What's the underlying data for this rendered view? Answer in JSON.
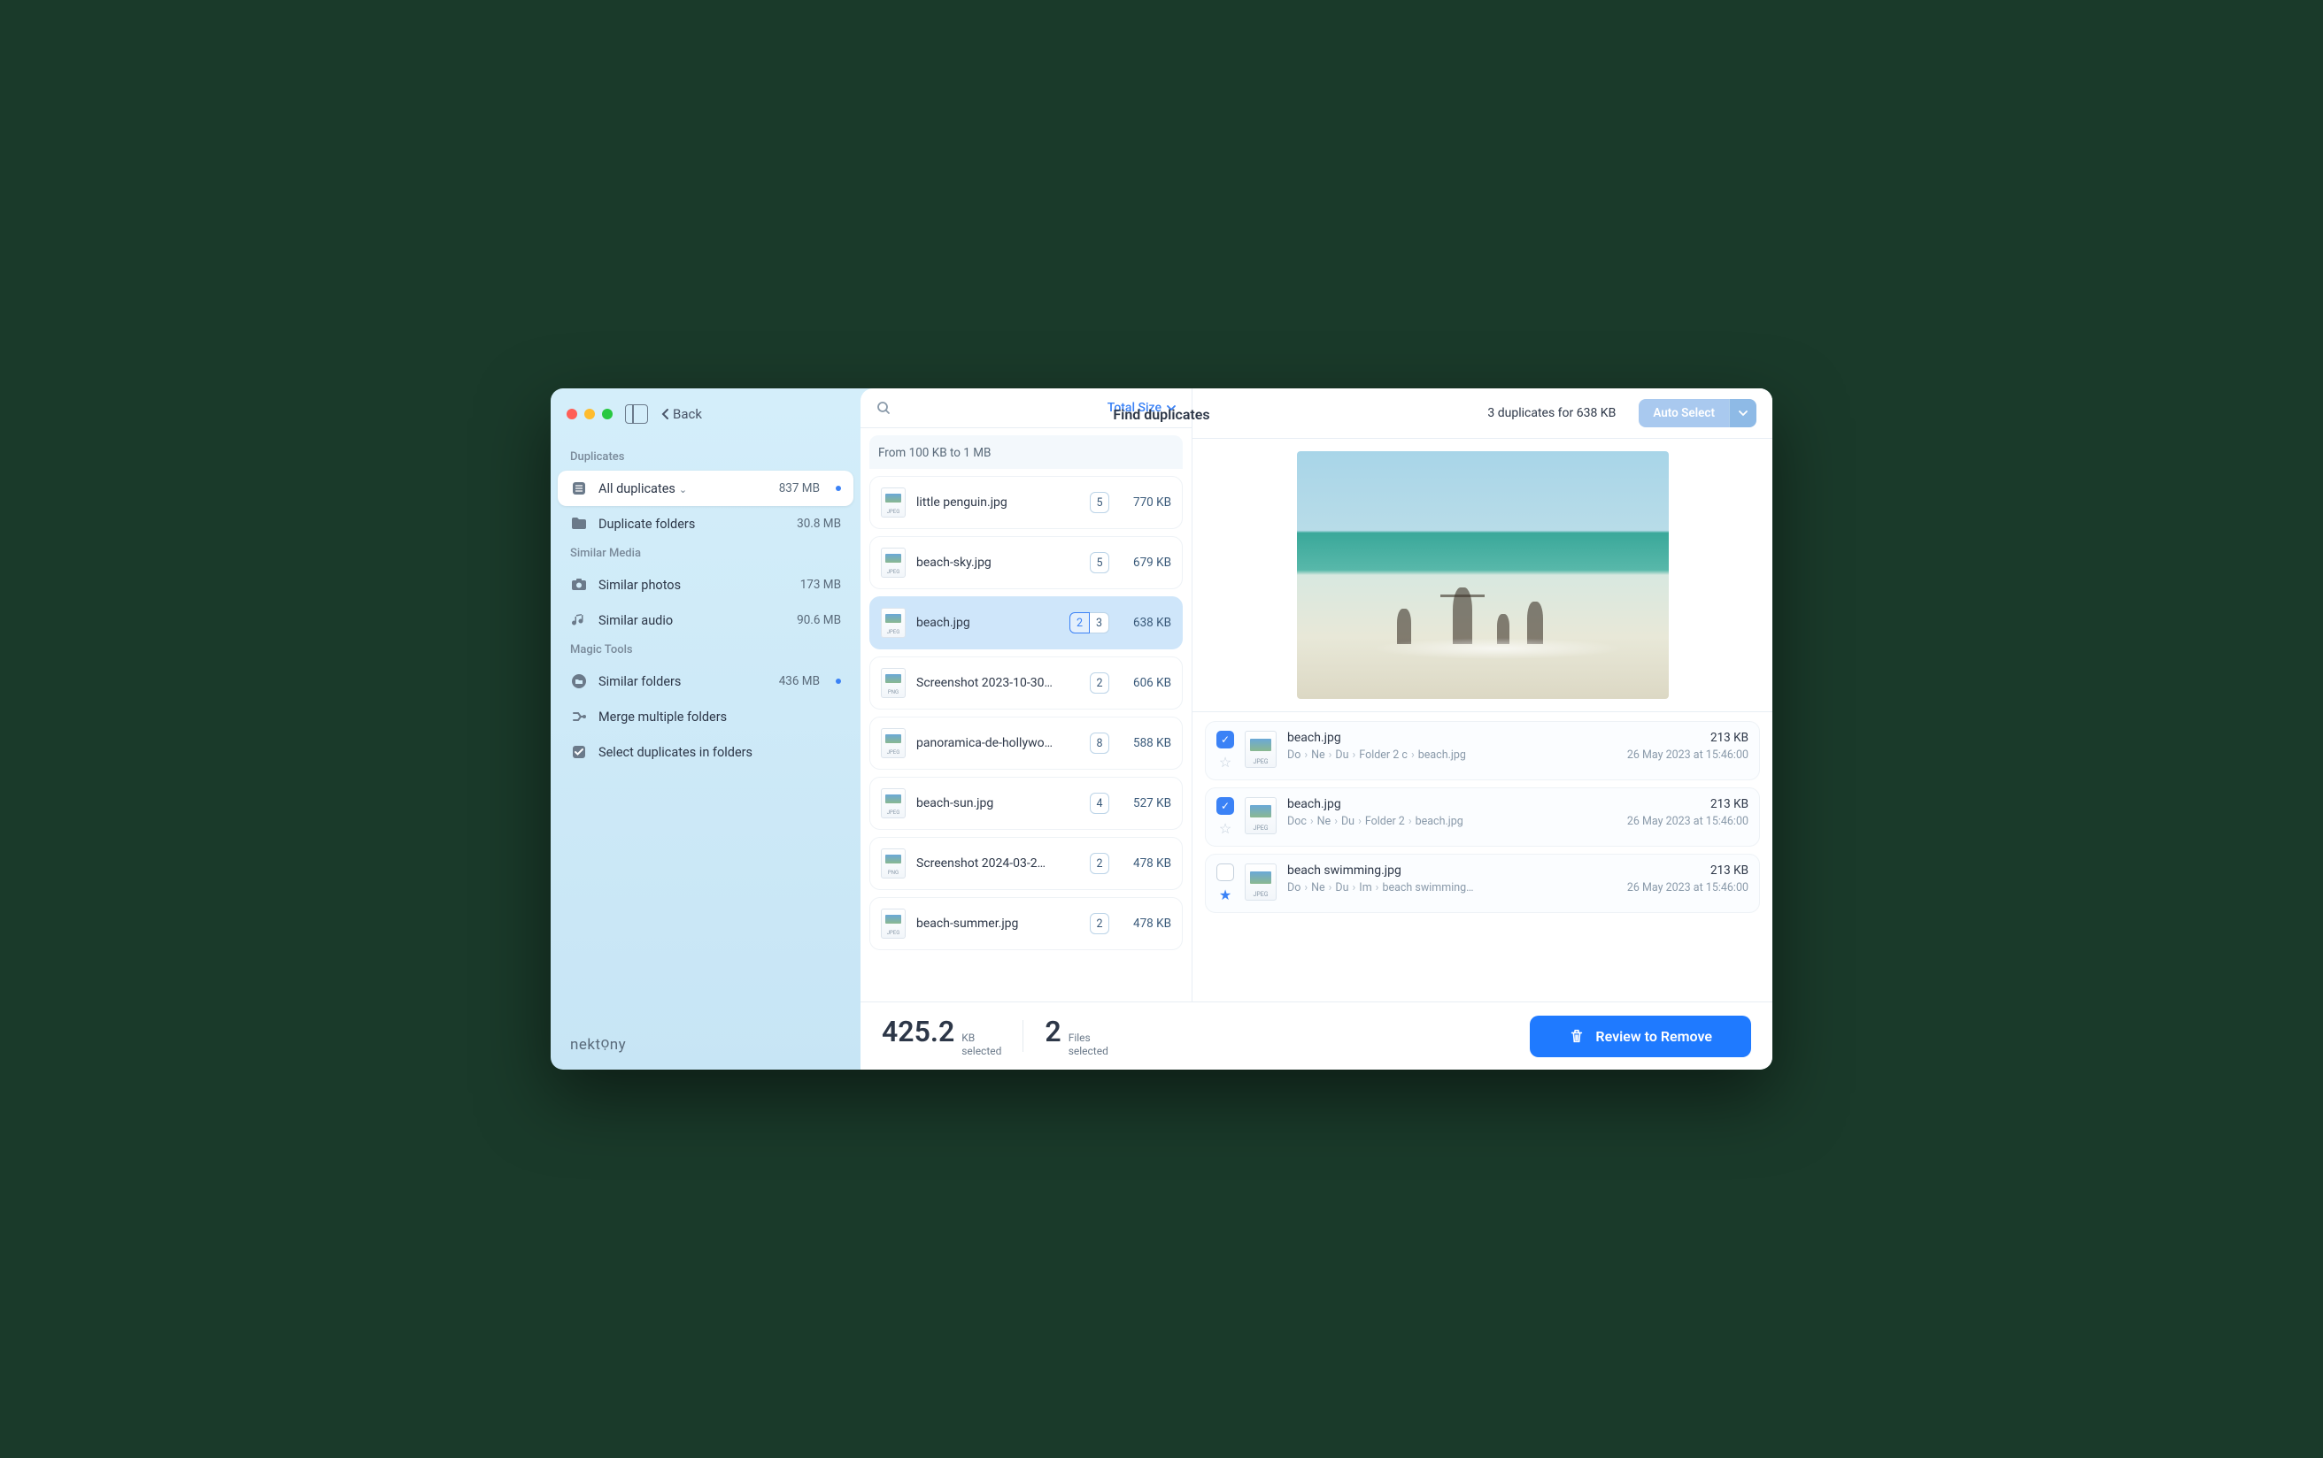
{
  "title": "Find duplicates",
  "back_label": "Back",
  "brand": "nektọny",
  "sidebar": {
    "sections": [
      {
        "label": "Duplicates",
        "items": [
          {
            "icon": "list",
            "label": "All duplicates",
            "size": "837 MB",
            "chevron": true,
            "dot": true,
            "active": true
          },
          {
            "icon": "folder",
            "label": "Duplicate folders",
            "size": "30.8 MB"
          }
        ]
      },
      {
        "label": "Similar Media",
        "items": [
          {
            "icon": "camera",
            "label": "Similar photos",
            "size": "173 MB"
          },
          {
            "icon": "music",
            "label": "Similar audio",
            "size": "90.6 MB"
          }
        ]
      },
      {
        "label": "Magic Tools",
        "items": [
          {
            "icon": "folders",
            "label": "Similar folders",
            "size": "436 MB",
            "dot": true
          },
          {
            "icon": "merge",
            "label": "Merge multiple folders"
          },
          {
            "icon": "check",
            "label": "Select duplicates in folders"
          }
        ]
      }
    ]
  },
  "middle": {
    "sort_label": "Total Size",
    "group_label": "From 100 KB to 1 MB",
    "files": [
      {
        "name": "little penguin.jpg",
        "ext": "JPEG",
        "badge": "5",
        "size": "770 KB"
      },
      {
        "name": "beach-sky.jpg",
        "ext": "JPEG",
        "badge": "5",
        "size": "679 KB"
      },
      {
        "name": "beach.jpg",
        "ext": "JPEG",
        "badge_split": [
          "2",
          "3"
        ],
        "size": "638 KB",
        "selected": true
      },
      {
        "name": "Screenshot 2023-10-30…",
        "ext": "PNG",
        "badge": "2",
        "size": "606 KB"
      },
      {
        "name": "panoramica-de-hollywo…",
        "ext": "JPEG",
        "badge": "8",
        "size": "588 KB"
      },
      {
        "name": "beach-sun.jpg",
        "ext": "JPEG",
        "badge": "4",
        "size": "527 KB"
      },
      {
        "name": "Screenshot 2024-03-2…",
        "ext": "PNG",
        "badge": "2",
        "size": "478 KB"
      },
      {
        "name": "beach-summer.jpg",
        "ext": "JPEG",
        "badge": "2",
        "size": "478 KB"
      }
    ]
  },
  "right": {
    "summary": "3 duplicates for 638 KB",
    "auto_select": "Auto Select",
    "duplicates": [
      {
        "checked": true,
        "starred": false,
        "name": "beach.jpg",
        "ext": "JPEG",
        "path": [
          "Do",
          "Ne",
          "Du",
          "Folder 2 c",
          "beach.jpg"
        ],
        "size": "213 KB",
        "date": "26 May 2023 at 15:46:00"
      },
      {
        "checked": true,
        "starred": false,
        "name": "beach.jpg",
        "ext": "JPEG",
        "path": [
          "Doc",
          "Ne",
          "Du",
          "Folder 2",
          "beach.jpg"
        ],
        "size": "213 KB",
        "date": "26 May 2023 at 15:46:00"
      },
      {
        "checked": false,
        "starred": true,
        "name": "beach swimming.jpg",
        "ext": "JPEG",
        "path": [
          "Do",
          "Ne",
          "Du",
          "Im",
          "beach swimming…"
        ],
        "size": "213 KB",
        "date": "26 May 2023 at 15:46:00"
      }
    ]
  },
  "footer": {
    "size_num": "425.2",
    "size_unit": "KB",
    "size_lbl": "selected",
    "files_num": "2",
    "files_unit": "Files",
    "files_lbl": "selected",
    "review": "Review to Remove"
  }
}
